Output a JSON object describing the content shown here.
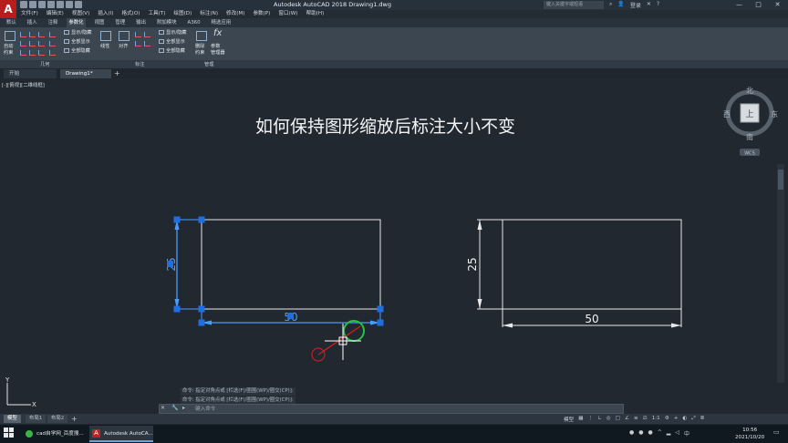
{
  "app": {
    "logo_letter": "A",
    "title": "Autodesk AutoCAD 2018    Drawing1.dwg",
    "search_placeholder": "键入关键字或短语",
    "sign_in": "登录"
  },
  "window_controls": [
    "—",
    "□",
    "✕"
  ],
  "menubar": [
    "文件(F)",
    "编辑(E)",
    "视图(V)",
    "插入(I)",
    "格式(O)",
    "工具(T)",
    "绘图(D)",
    "标注(N)",
    "修改(M)",
    "参数(P)",
    "窗口(W)",
    "帮助(H)"
  ],
  "ribbon_tabs": [
    {
      "label": "默认",
      "active": false
    },
    {
      "label": "插入",
      "active": false
    },
    {
      "label": "注释",
      "active": false
    },
    {
      "label": "参数化",
      "active": true
    },
    {
      "label": "视图",
      "active": false
    },
    {
      "label": "管理",
      "active": false
    },
    {
      "label": "输出",
      "active": false
    },
    {
      "label": "附加模块",
      "active": false
    },
    {
      "label": "A360",
      "active": false
    },
    {
      "label": "精选应用",
      "active": false
    }
  ],
  "ribbon": {
    "auto_constrain": "自动\n约束",
    "geo_panel": {
      "label": "几何",
      "show_hide": "显示/隐藏",
      "show_all": "全部显示",
      "hide_all": "全部隐藏"
    },
    "dim_panel": {
      "label": "标注",
      "linear": "线性",
      "aligned": "对齐",
      "show_hide": "显示/隐藏",
      "show_all": "全部显示",
      "hide_all": "全部隐藏"
    },
    "manage_panel": {
      "label": "管理",
      "delete": "删除\n约束",
      "params": "参数\n管理器"
    }
  },
  "doc_tabs": [
    {
      "label": "开始",
      "active": false
    },
    {
      "label": "Drawing1*",
      "active": true
    }
  ],
  "viewport_label": "[-][俯视][二维线框]",
  "headline": "如何保持图形缩放后标注大小不变",
  "viewcube": {
    "north": "北",
    "south": "南",
    "east": "东",
    "west": "西",
    "top": "上",
    "wcs": "WCS"
  },
  "drawing": {
    "left": {
      "width_dim": "50",
      "height_dim": "25"
    },
    "right": {
      "width_dim": "50",
      "height_dim": "25"
    }
  },
  "ucs": {
    "x": "X",
    "y": "Y"
  },
  "command": {
    "history": [
      "命令: 指定对角点或 [栏选(F)/圈围(WP)/圈交(CP)]:",
      "命令: 指定对角点或 [栏选(F)/圈围(WP)/圈交(CP)]:"
    ],
    "prompt": "键入命令"
  },
  "layout_tabs": [
    {
      "label": "模型",
      "active": true
    },
    {
      "label": "布局1",
      "active": false
    },
    {
      "label": "布局2",
      "active": false
    }
  ],
  "status": {
    "model": "模型",
    "scale": "1:1"
  },
  "taskbar": {
    "tasks": [
      {
        "label": "cad自学网_百度搜...",
        "active": false
      },
      {
        "label": "Autodesk AutoCA...",
        "active": true
      }
    ],
    "time": "10:56",
    "date": "2021/10/20"
  },
  "colors": {
    "canvas": "#212830",
    "grip": "#1f6fe0",
    "selected": "#4a9cff",
    "osnap": "#22c24a",
    "marker": "#c02020"
  }
}
